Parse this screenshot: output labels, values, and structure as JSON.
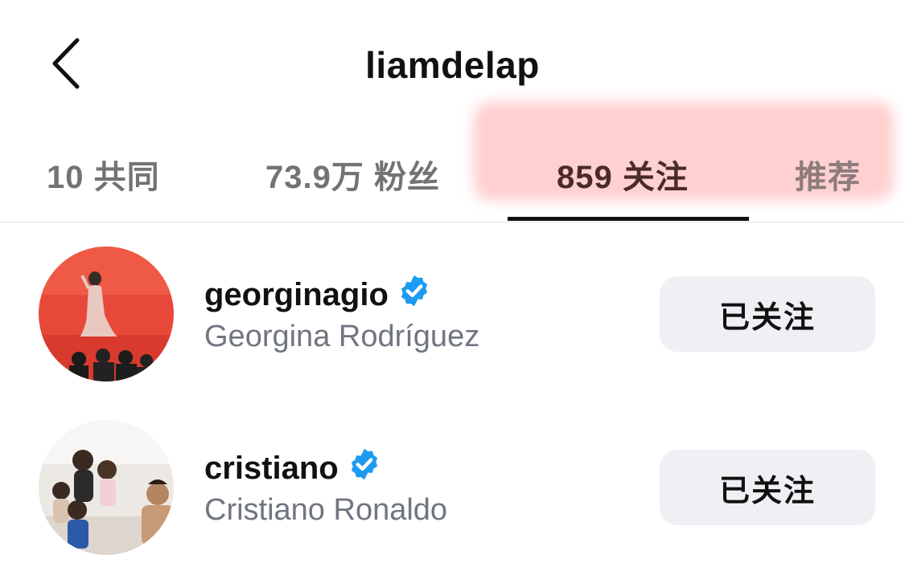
{
  "header": {
    "title": "liamdelap",
    "back_icon": "chevron-left-icon"
  },
  "tabs": [
    {
      "label": "10 共同",
      "active": false
    },
    {
      "label": "73.9万 粉丝",
      "active": false
    },
    {
      "label": "859 关注",
      "active": true
    },
    {
      "label": "推荐",
      "active": false
    }
  ],
  "users": [
    {
      "username": "georginagio",
      "full_name": "Georgina Rodríguez",
      "verified": true,
      "button_label": "已关注"
    },
    {
      "username": "cristiano",
      "full_name": "Cristiano Ronaldo",
      "verified": true,
      "button_label": "已关注"
    }
  ],
  "colors": {
    "verified_badge": "#1d9bf0",
    "button_bg": "#eff0f4",
    "secondary_text": "#707580",
    "tab_highlight": "#ffb0b0"
  }
}
